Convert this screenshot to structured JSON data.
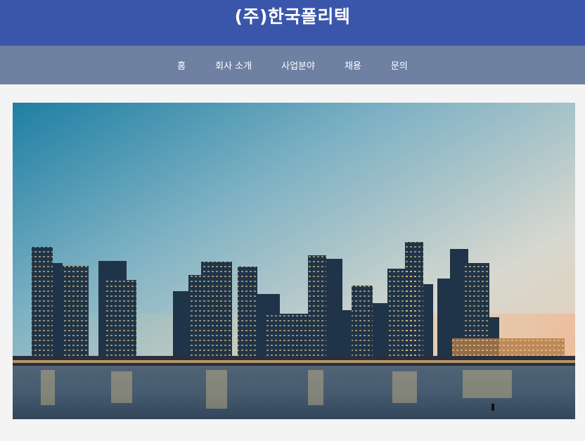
{
  "header": {
    "title": "(주)한국폴리텍"
  },
  "nav": {
    "items": [
      {
        "label": "홈"
      },
      {
        "label": "회사 소개"
      },
      {
        "label": "사업분야"
      },
      {
        "label": "채용"
      },
      {
        "label": "문의"
      }
    ]
  },
  "colors": {
    "header_bg": "#3a56ab",
    "nav_bg": "#6f81a3",
    "page_bg": "#f4f4f4"
  },
  "hero": {
    "image": "city-skyline-at-dusk-over-water"
  }
}
